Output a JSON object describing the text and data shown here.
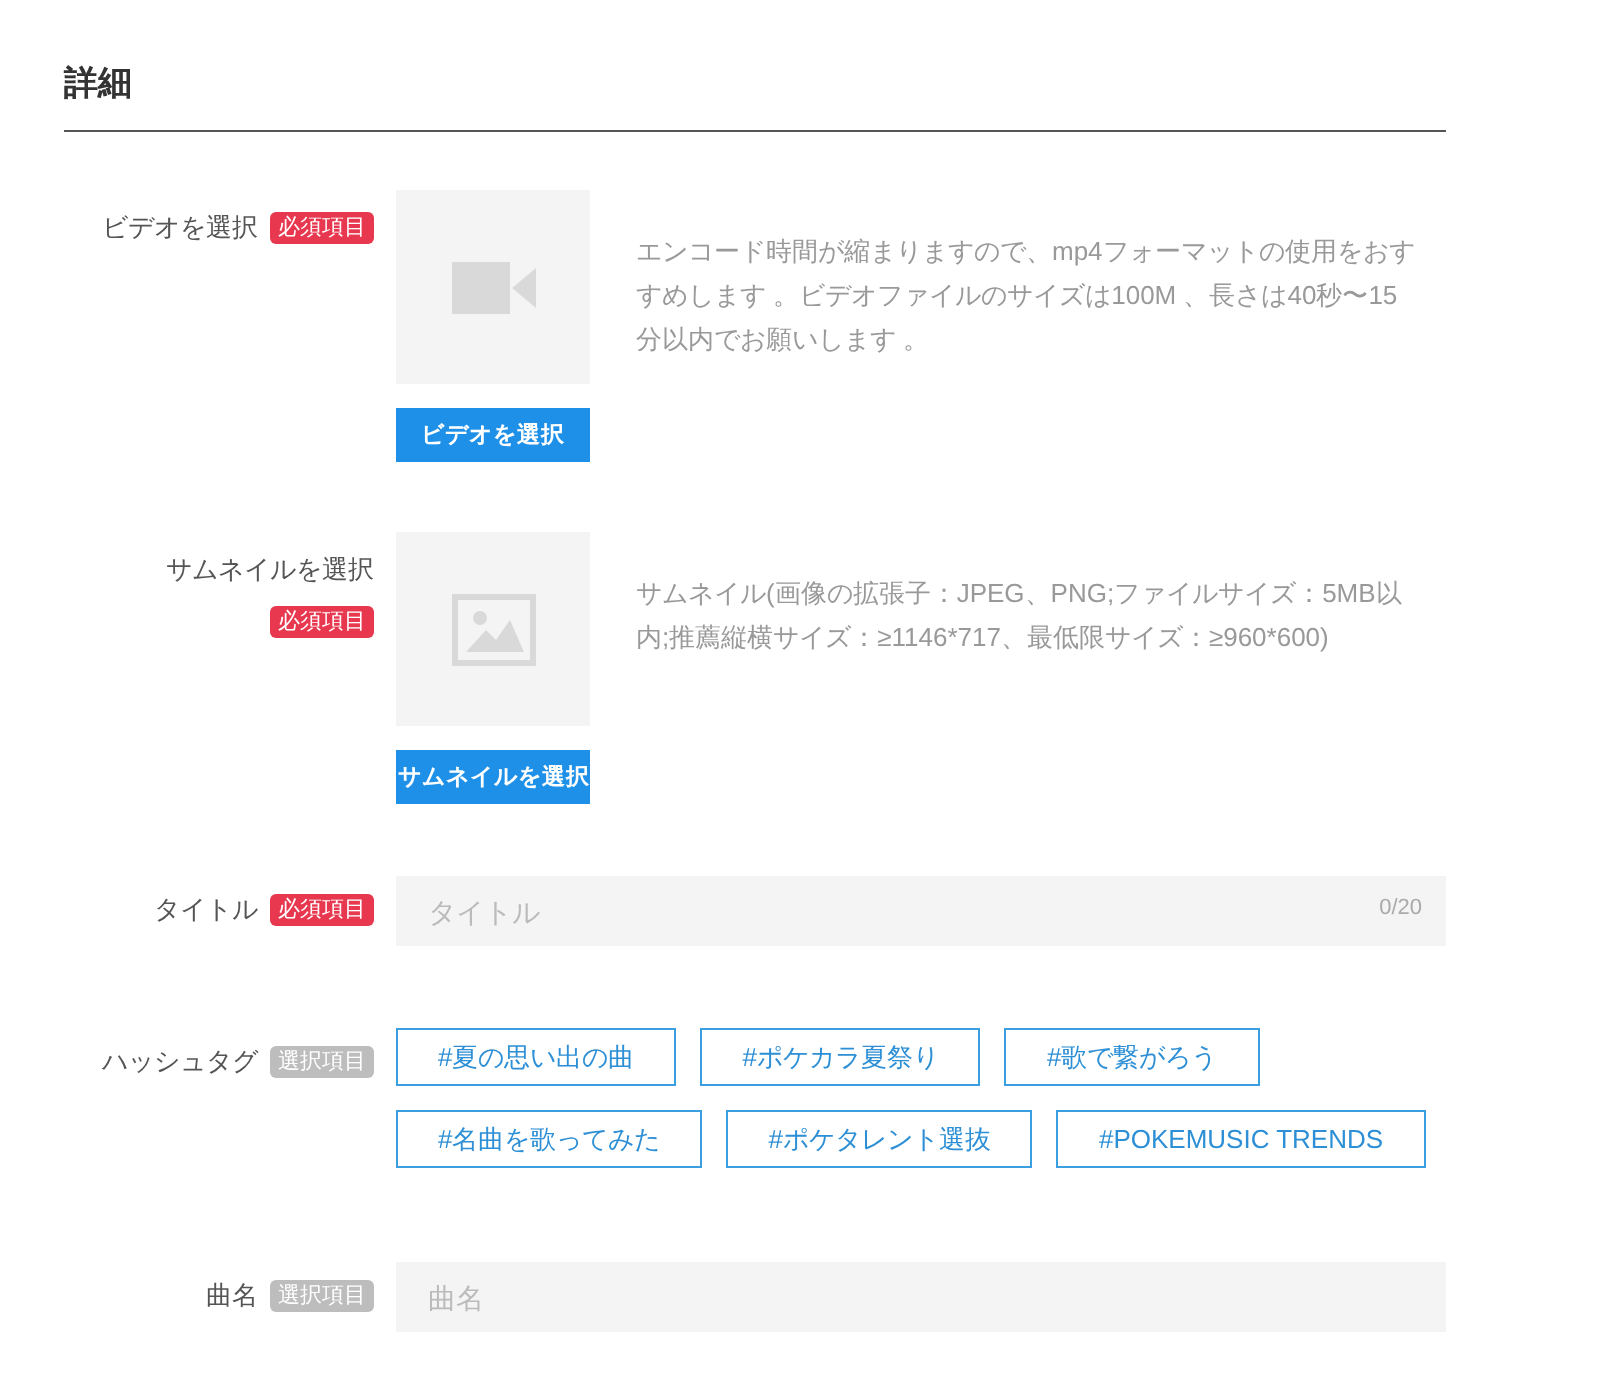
{
  "heading": "詳細",
  "fields": [
    {
      "kind": "video_upload",
      "label": "ビデオを選択",
      "badge": "必須項目",
      "required": true,
      "button": "ビデオを選択",
      "description": "エンコード時間が縮まりますので、mp4フォーマットの使用をおすすめします 。ビデオファイルのサイズは100M 、長さは40秒〜15分以内でお願いします 。"
    },
    {
      "kind": "image_upload",
      "label": "サムネイルを選択",
      "badge": "必須項目",
      "required": true,
      "button": "サムネイルを選択",
      "description": "サムネイル(画像の拡張子：JPEG、PNG;ファイルサイズ：5MB以内;推薦縦横サイズ：≥1146*717、最低限サイズ：≥960*600)"
    },
    {
      "kind": "text",
      "label": "タイトル",
      "badge": "必須項目",
      "required": true,
      "placeholder": "タイトル",
      "counter": "0/20"
    },
    {
      "kind": "tags",
      "label": "ハッシュタグ",
      "badge": "選択項目",
      "required": false,
      "tags": [
        "#夏の思い出の曲",
        "#ポケカラ夏祭り",
        "#歌で繋がろう",
        "#名曲を歌ってみた",
        "#ポケタレント選抜",
        "#POKEMUSIC TRENDS"
      ]
    },
    {
      "kind": "text",
      "label": "曲名",
      "badge": "選択項目",
      "required": false,
      "placeholder": "曲名"
    }
  ]
}
